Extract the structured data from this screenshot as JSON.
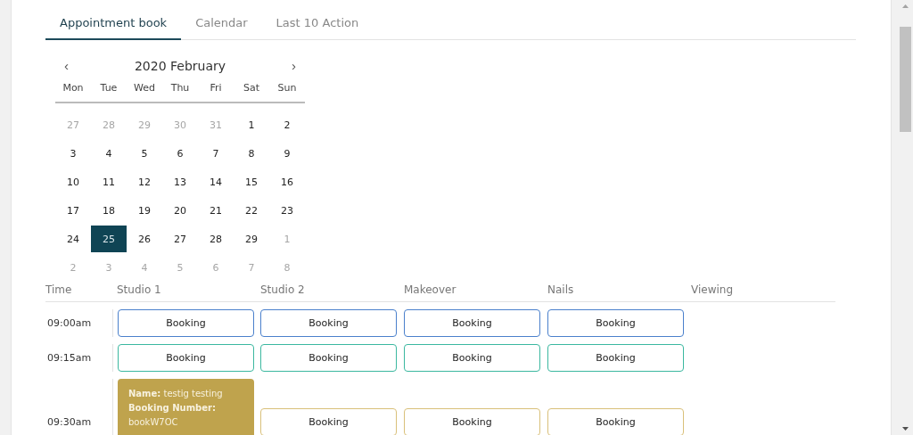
{
  "tabs": [
    {
      "label": "Appointment book",
      "selected": true
    },
    {
      "label": "Calendar",
      "selected": false
    },
    {
      "label": "Last 10 Action",
      "selected": false
    }
  ],
  "calendar": {
    "prev": "‹",
    "title": "2020 February",
    "next": "›",
    "weekdays": [
      "Mon",
      "Tue",
      "Wed",
      "Thu",
      "Fri",
      "Sat",
      "Sun"
    ],
    "days": [
      {
        "label": "27",
        "muted": true,
        "selected": false
      },
      {
        "label": "28",
        "muted": true,
        "selected": false
      },
      {
        "label": "29",
        "muted": true,
        "selected": false
      },
      {
        "label": "30",
        "muted": true,
        "selected": false
      },
      {
        "label": "31",
        "muted": true,
        "selected": false
      },
      {
        "label": "1",
        "muted": false,
        "selected": false
      },
      {
        "label": "2",
        "muted": false,
        "selected": false
      },
      {
        "label": "3",
        "muted": false,
        "selected": false
      },
      {
        "label": "4",
        "muted": false,
        "selected": false
      },
      {
        "label": "5",
        "muted": false,
        "selected": false
      },
      {
        "label": "6",
        "muted": false,
        "selected": false
      },
      {
        "label": "7",
        "muted": false,
        "selected": false
      },
      {
        "label": "8",
        "muted": false,
        "selected": false
      },
      {
        "label": "9",
        "muted": false,
        "selected": false
      },
      {
        "label": "10",
        "muted": false,
        "selected": false
      },
      {
        "label": "11",
        "muted": false,
        "selected": false
      },
      {
        "label": "12",
        "muted": false,
        "selected": false
      },
      {
        "label": "13",
        "muted": false,
        "selected": false
      },
      {
        "label": "14",
        "muted": false,
        "selected": false
      },
      {
        "label": "15",
        "muted": false,
        "selected": false
      },
      {
        "label": "16",
        "muted": false,
        "selected": false
      },
      {
        "label": "17",
        "muted": false,
        "selected": false
      },
      {
        "label": "18",
        "muted": false,
        "selected": false
      },
      {
        "label": "19",
        "muted": false,
        "selected": false
      },
      {
        "label": "20",
        "muted": false,
        "selected": false
      },
      {
        "label": "21",
        "muted": false,
        "selected": false
      },
      {
        "label": "22",
        "muted": false,
        "selected": false
      },
      {
        "label": "23",
        "muted": false,
        "selected": false
      },
      {
        "label": "24",
        "muted": false,
        "selected": false
      },
      {
        "label": "25",
        "muted": false,
        "selected": true
      },
      {
        "label": "26",
        "muted": false,
        "selected": false
      },
      {
        "label": "27",
        "muted": false,
        "selected": false
      },
      {
        "label": "28",
        "muted": false,
        "selected": false
      },
      {
        "label": "29",
        "muted": false,
        "selected": false
      },
      {
        "label": "1",
        "muted": true,
        "selected": false
      },
      {
        "label": "2",
        "muted": true,
        "selected": false
      },
      {
        "label": "3",
        "muted": true,
        "selected": false
      },
      {
        "label": "4",
        "muted": true,
        "selected": false
      },
      {
        "label": "5",
        "muted": true,
        "selected": false
      },
      {
        "label": "6",
        "muted": true,
        "selected": false
      },
      {
        "label": "7",
        "muted": true,
        "selected": false
      },
      {
        "label": "8",
        "muted": true,
        "selected": false
      }
    ]
  },
  "schedule": {
    "columns": [
      "Time",
      "Studio 1",
      "Studio 2",
      "Makeover",
      "Nails",
      "Viewing"
    ],
    "rows": [
      {
        "time": "09:00am",
        "cells": [
          {
            "kind": "button",
            "label": "Booking",
            "color": "#4a80cc"
          },
          {
            "kind": "button",
            "label": "Booking",
            "color": "#4a80cc"
          },
          {
            "kind": "button",
            "label": "Booking",
            "color": "#4a80cc"
          },
          {
            "kind": "button",
            "label": "Booking",
            "color": "#4a80cc"
          }
        ]
      },
      {
        "time": "09:15am",
        "cells": [
          {
            "kind": "button",
            "label": "Booking",
            "color": "#3bb8a0"
          },
          {
            "kind": "button",
            "label": "Booking",
            "color": "#3bb8a0"
          },
          {
            "kind": "button",
            "label": "Booking",
            "color": "#3bb8a0"
          },
          {
            "kind": "button",
            "label": "Booking",
            "color": "#3bb8a0"
          }
        ]
      },
      {
        "time": "09:30am",
        "cells": [
          {
            "kind": "appointment",
            "lines": [
              "**Name:** testig testing",
              "**Booking Number:**",
              "bookW7OC"
            ],
            "color": "#bfa34d"
          },
          {
            "kind": "button",
            "label": "Booking",
            "color": "#d9c07a"
          },
          {
            "kind": "button",
            "label": "Booking",
            "color": "#d9c07a"
          },
          {
            "kind": "button",
            "label": "Booking",
            "color": "#d9c07a"
          }
        ]
      }
    ]
  }
}
